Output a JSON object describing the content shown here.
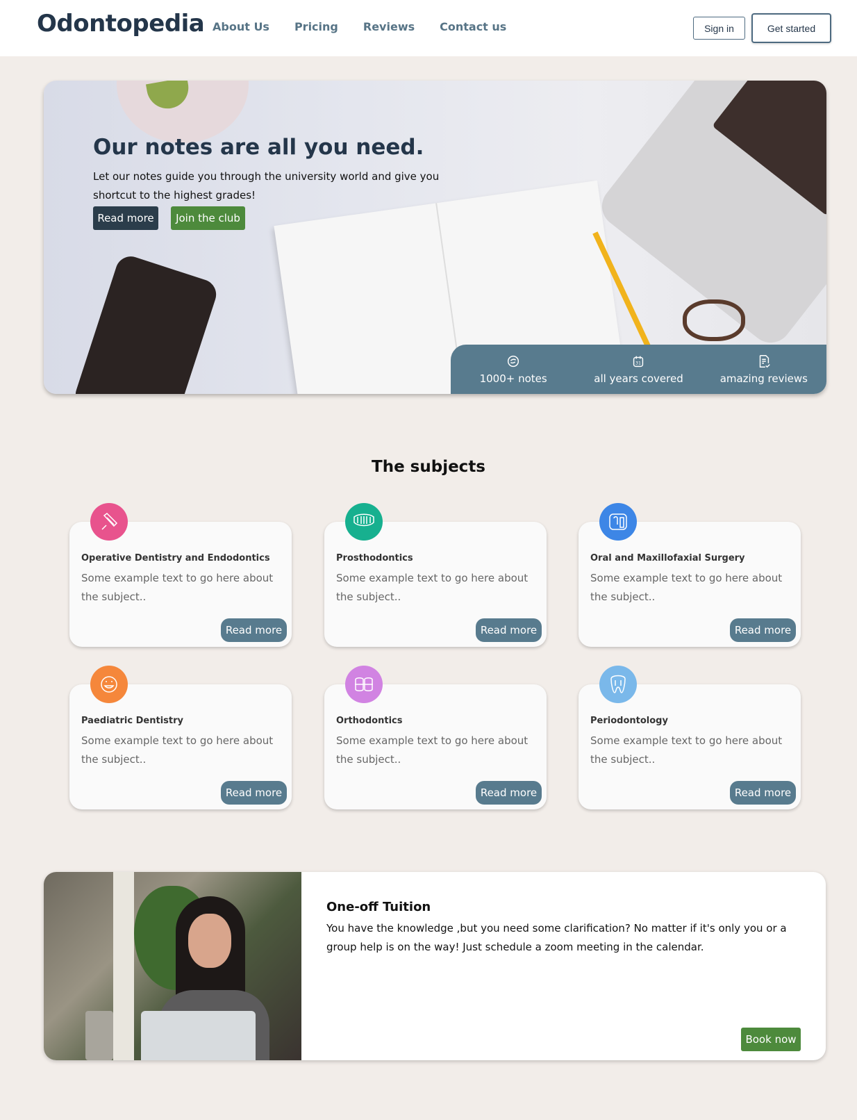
{
  "header": {
    "logo": "Odontopedia",
    "nav": [
      "About Us",
      "Pricing",
      "Reviews",
      "Contact us"
    ],
    "sign_in": "Sign in",
    "get_started": "Get started"
  },
  "hero": {
    "title": "Our notes are all you need.",
    "text": "Let our notes guide you through the university world and give you shortcut to the highest grades!",
    "read_more": "Read more",
    "join": "Join the club",
    "stats": [
      {
        "icon": "notes-icon",
        "label": "1000+ notes"
      },
      {
        "icon": "calendar-icon",
        "label": "all years covered"
      },
      {
        "icon": "reviews-icon",
        "label": "amazing reviews"
      }
    ]
  },
  "subjects": {
    "title": "The subjects",
    "cards": [
      {
        "icon": "syringe-icon",
        "color": "#e8538d",
        "title": "Operative Dentistry and Endodontics",
        "text": "Some example text to go here about the subject..",
        "button": "Read more"
      },
      {
        "icon": "dentures-icon",
        "color": "#17b08f",
        "title": "Prosthodontics",
        "text": "Some example text to go here about the subject..",
        "button": "Read more"
      },
      {
        "icon": "implant-icon",
        "color": "#3d86e6",
        "title": "Oral and Maxillofaxial Surgery",
        "text": "Some example text to go here about the subject..",
        "button": "Read more"
      },
      {
        "icon": "child-smile-icon",
        "color": "#f5873b",
        "title": "Paediatric Dentistry",
        "text": "Some example text to go here about the subject..",
        "button": "Read more"
      },
      {
        "icon": "braces-icon",
        "color": "#d183e2",
        "title": "Orthodontics",
        "text": "Some example text to go here about the subject..",
        "button": "Read more"
      },
      {
        "icon": "tooth-root-icon",
        "color": "#7ab8ea",
        "title": "Periodontology",
        "text": "Some example text to go here about the subject..",
        "button": "Read more"
      }
    ]
  },
  "tuition": {
    "title": "One-off Tuition",
    "text": "You have the knowledge ,but you need some clarification? No matter if it's only you or a group help is on the way! Just schedule a zoom meeting in the calendar.",
    "button": "Book now"
  }
}
